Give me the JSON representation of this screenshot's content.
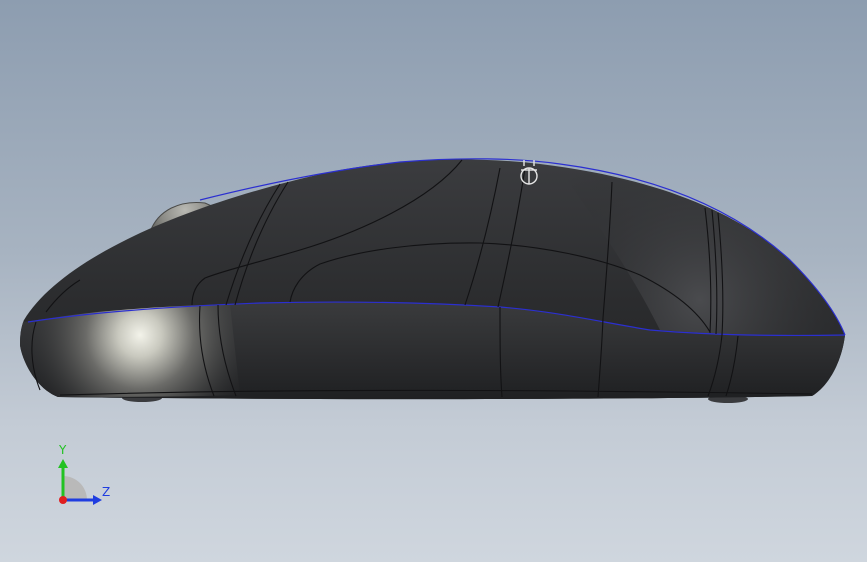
{
  "viewport": {
    "background_top": "#8d9db0",
    "background_bottom": "#cfd6de"
  },
  "model": {
    "body_color": "#2c2d2f",
    "edge_color": "#1a1a2e",
    "silhouette_color": "#2b2fd0",
    "wheel_color": "#8f8f8a"
  },
  "triad": {
    "y_label": "Y",
    "z_label": "Z",
    "y_color": "#22c222",
    "z_color": "#1f3de0",
    "x_color": "#e01f1f"
  }
}
